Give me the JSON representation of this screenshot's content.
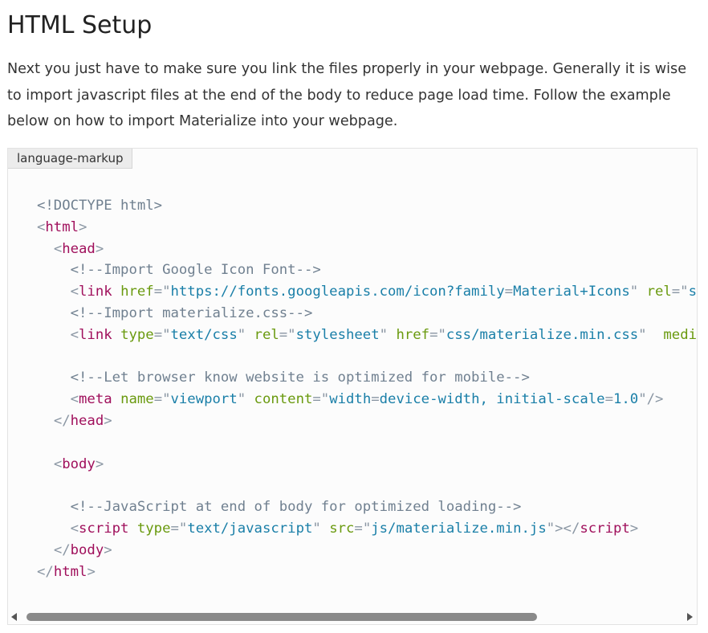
{
  "section": {
    "title": "HTML Setup",
    "intro": "Next you just have to make sure you link the files properly in your webpage. Generally it is wise to import javascript files at the end of the body to reduce page load time. Follow the example below on how to import Materialize into your webpage."
  },
  "code_block": {
    "language_label": "language-markup",
    "lines": [
      [
        {
          "t": "doctype",
          "v": "<!DOCTYPE html>"
        }
      ],
      [
        {
          "t": "punct",
          "v": "<"
        },
        {
          "t": "tag",
          "v": "html"
        },
        {
          "t": "punct",
          "v": ">"
        }
      ],
      [
        {
          "t": "plain",
          "v": "  "
        },
        {
          "t": "punct",
          "v": "<"
        },
        {
          "t": "tag",
          "v": "head"
        },
        {
          "t": "punct",
          "v": ">"
        }
      ],
      [
        {
          "t": "plain",
          "v": "    "
        },
        {
          "t": "comment",
          "v": "<!--Import Google Icon Font-->"
        }
      ],
      [
        {
          "t": "plain",
          "v": "    "
        },
        {
          "t": "punct",
          "v": "<"
        },
        {
          "t": "tag",
          "v": "link"
        },
        {
          "t": "plain",
          "v": " "
        },
        {
          "t": "attr",
          "v": "href"
        },
        {
          "t": "punct",
          "v": "=\""
        },
        {
          "t": "value",
          "v": "https://fonts.googleapis.com/icon?family"
        },
        {
          "t": "punct",
          "v": "="
        },
        {
          "t": "value",
          "v": "Material+Icons"
        },
        {
          "t": "punct",
          "v": "\""
        },
        {
          "t": "plain",
          "v": " "
        },
        {
          "t": "attr",
          "v": "rel"
        },
        {
          "t": "punct",
          "v": "=\""
        },
        {
          "t": "value",
          "v": "st"
        }
      ],
      [
        {
          "t": "plain",
          "v": "    "
        },
        {
          "t": "comment",
          "v": "<!--Import materialize.css-->"
        }
      ],
      [
        {
          "t": "plain",
          "v": "    "
        },
        {
          "t": "punct",
          "v": "<"
        },
        {
          "t": "tag",
          "v": "link"
        },
        {
          "t": "plain",
          "v": " "
        },
        {
          "t": "attr",
          "v": "type"
        },
        {
          "t": "punct",
          "v": "=\""
        },
        {
          "t": "value",
          "v": "text/css"
        },
        {
          "t": "punct",
          "v": "\""
        },
        {
          "t": "plain",
          "v": " "
        },
        {
          "t": "attr",
          "v": "rel"
        },
        {
          "t": "punct",
          "v": "=\""
        },
        {
          "t": "value",
          "v": "stylesheet"
        },
        {
          "t": "punct",
          "v": "\""
        },
        {
          "t": "plain",
          "v": " "
        },
        {
          "t": "attr",
          "v": "href"
        },
        {
          "t": "punct",
          "v": "=\""
        },
        {
          "t": "value",
          "v": "css/materialize.min.css"
        },
        {
          "t": "punct",
          "v": "\""
        },
        {
          "t": "plain",
          "v": "  "
        },
        {
          "t": "attr",
          "v": "media"
        }
      ],
      [
        {
          "t": "plain",
          "v": ""
        }
      ],
      [
        {
          "t": "plain",
          "v": "    "
        },
        {
          "t": "comment",
          "v": "<!--Let browser know website is optimized for mobile-->"
        }
      ],
      [
        {
          "t": "plain",
          "v": "    "
        },
        {
          "t": "punct",
          "v": "<"
        },
        {
          "t": "tag",
          "v": "meta"
        },
        {
          "t": "plain",
          "v": " "
        },
        {
          "t": "attr",
          "v": "name"
        },
        {
          "t": "punct",
          "v": "=\""
        },
        {
          "t": "value",
          "v": "viewport"
        },
        {
          "t": "punct",
          "v": "\""
        },
        {
          "t": "plain",
          "v": " "
        },
        {
          "t": "attr",
          "v": "content"
        },
        {
          "t": "punct",
          "v": "=\""
        },
        {
          "t": "value",
          "v": "width"
        },
        {
          "t": "punct",
          "v": "="
        },
        {
          "t": "value",
          "v": "device-width, initial-scale"
        },
        {
          "t": "punct",
          "v": "="
        },
        {
          "t": "value",
          "v": "1.0"
        },
        {
          "t": "punct",
          "v": "\"/>"
        }
      ],
      [
        {
          "t": "plain",
          "v": "  "
        },
        {
          "t": "punct",
          "v": "</"
        },
        {
          "t": "tag",
          "v": "head"
        },
        {
          "t": "punct",
          "v": ">"
        }
      ],
      [
        {
          "t": "plain",
          "v": ""
        }
      ],
      [
        {
          "t": "plain",
          "v": "  "
        },
        {
          "t": "punct",
          "v": "<"
        },
        {
          "t": "tag",
          "v": "body"
        },
        {
          "t": "punct",
          "v": ">"
        }
      ],
      [
        {
          "t": "plain",
          "v": ""
        }
      ],
      [
        {
          "t": "plain",
          "v": "    "
        },
        {
          "t": "comment",
          "v": "<!--JavaScript at end of body for optimized loading-->"
        }
      ],
      [
        {
          "t": "plain",
          "v": "    "
        },
        {
          "t": "punct",
          "v": "<"
        },
        {
          "t": "tag",
          "v": "script"
        },
        {
          "t": "plain",
          "v": " "
        },
        {
          "t": "attr",
          "v": "type"
        },
        {
          "t": "punct",
          "v": "=\""
        },
        {
          "t": "value",
          "v": "text/javascript"
        },
        {
          "t": "punct",
          "v": "\""
        },
        {
          "t": "plain",
          "v": " "
        },
        {
          "t": "attr",
          "v": "src"
        },
        {
          "t": "punct",
          "v": "=\""
        },
        {
          "t": "value",
          "v": "js/materialize.min.js"
        },
        {
          "t": "punct",
          "v": "\"></"
        },
        {
          "t": "tag",
          "v": "script"
        },
        {
          "t": "punct",
          "v": ">"
        }
      ],
      [
        {
          "t": "plain",
          "v": "  "
        },
        {
          "t": "punct",
          "v": "</"
        },
        {
          "t": "tag",
          "v": "body"
        },
        {
          "t": "punct",
          "v": ">"
        }
      ],
      [
        {
          "t": "punct",
          "v": "</"
        },
        {
          "t": "tag",
          "v": "html"
        },
        {
          "t": "punct",
          "v": ">"
        }
      ]
    ]
  },
  "scrollbar": {
    "orientation": "horizontal",
    "left_arrow_icon": "triangle-left-icon",
    "right_arrow_icon": "triangle-right-icon"
  },
  "colors": {
    "tag": "#a0105c",
    "attribute": "#6a9a0f",
    "value": "#1a7fa8",
    "comment": "#708090",
    "punctuation": "#8a96a3",
    "code_background": "#fcfcfc"
  }
}
